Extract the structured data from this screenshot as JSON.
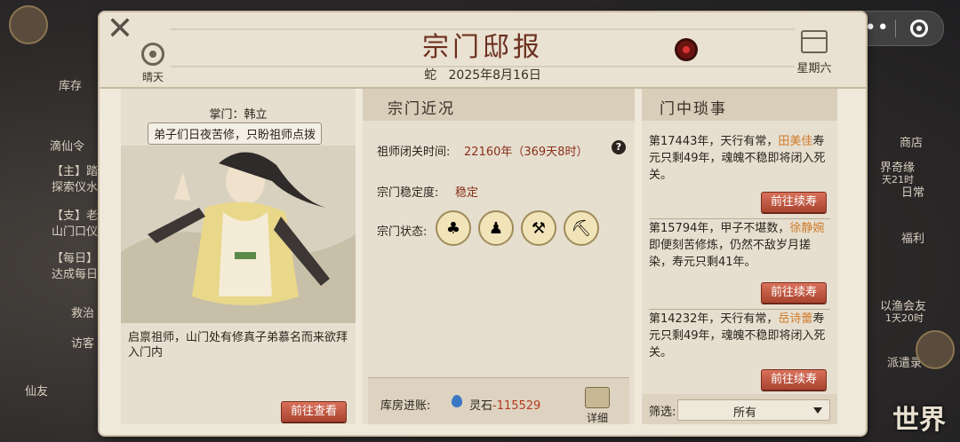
{
  "background": {
    "left_items": [
      "库存",
      "滴仙令",
      "【主】踏歌",
      "探索仪水",
      "【支】老道",
      "山门口仪",
      "【每日】日",
      "达成每日",
      "救治",
      "访客",
      "仙友"
    ],
    "right_items": [
      "商店",
      "界奇缘",
      "天21时",
      "日常",
      "福利",
      "以渔会友",
      "1天20时",
      "派遣录"
    ]
  },
  "capsule": {
    "dots": "•••"
  },
  "header": {
    "title": "宗门邸报",
    "era": "蛇",
    "date": "2025年8月16日",
    "weather": "晴天",
    "weekday": "星期六",
    "close_icon": "close-icon"
  },
  "left": {
    "leader_label": "掌门：韩立",
    "bubble": "弟子们日夜苦修，只盼祖师点拨",
    "notice": "启禀祖师，山门处有修真子弟慕名而来欲拜入门内",
    "button": "前往查看"
  },
  "middle": {
    "section_title": "宗门近况",
    "retreat_label": "祖师闭关时间:",
    "retreat_value": "22160年（369天8时）",
    "stability_label": "宗门稳定度:",
    "stability_value": "稳定",
    "status_label": "宗门状态:",
    "status_icons": [
      "disciple-status-icon",
      "elders-status-icon",
      "hammer-status-icon",
      "mining-status-icon"
    ],
    "ledger_label": "库房进账:",
    "ledger_item": "灵石",
    "ledger_value": "-115529",
    "detail_label": "详细"
  },
  "right": {
    "section_title": "门中琐事",
    "events": [
      {
        "prefix": "第17443年，天行有常，",
        "name": "田美佳",
        "suffix": "寿元只剩49年，魂魄不稳即将闭入死关。",
        "button": "前往续寿"
      },
      {
        "prefix": "第15794年，甲子不堪数，",
        "name": "徐静婉",
        "suffix": "即便刻苦修炼，仍然不敌岁月搓染，寿元只剩41年。",
        "button": "前往续寿"
      },
      {
        "prefix": "第14232年，天行有常，",
        "name": "岳诗蕾",
        "suffix": "寿元只剩49年，魂魄不稳即将闭入死关。",
        "button": "前往续寿"
      }
    ],
    "filter_label": "筛选:",
    "filter_value": "所有"
  },
  "world_label": "世界"
}
